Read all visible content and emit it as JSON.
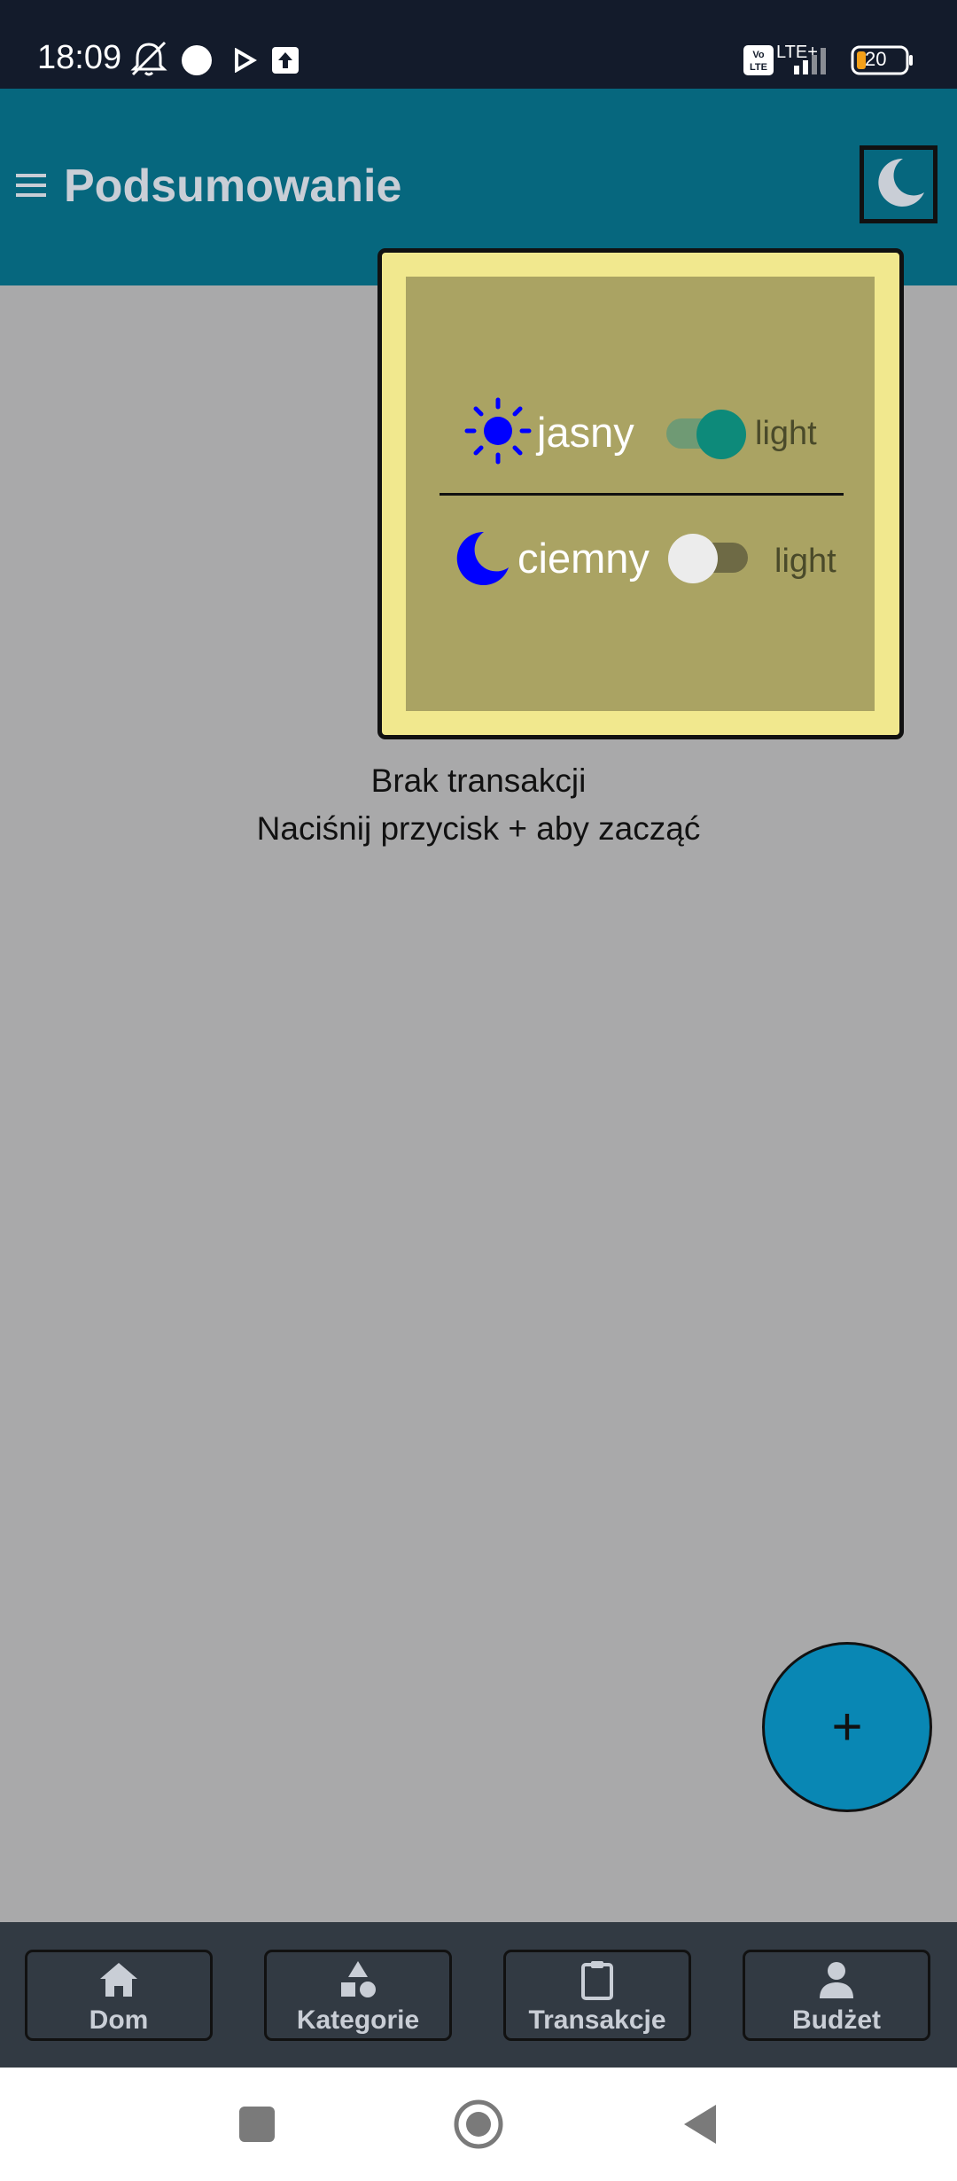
{
  "status_bar": {
    "time": "18:09",
    "network": "LTE+",
    "volte": "Vo LTE",
    "battery": "20"
  },
  "app_bar": {
    "title": "Podsumowanie",
    "menu_icon": "hamburger-menu-icon",
    "theme_icon": "moon-icon"
  },
  "theme_popup": {
    "options": [
      {
        "icon": "sun-icon",
        "label": "jasny",
        "switch_on": true,
        "switch_text": "light"
      },
      {
        "icon": "moon-icon",
        "label": "ciemny",
        "switch_on": false,
        "switch_text": "light"
      }
    ]
  },
  "empty_state": {
    "line1": "Brak transakcji",
    "line2": "Naciśnij przycisk + aby zacząć"
  },
  "fab": {
    "label": "+"
  },
  "bottom_nav": {
    "items": [
      {
        "label": "Dom",
        "icon": "home-icon"
      },
      {
        "label": "Kategorie",
        "icon": "shapes-icon"
      },
      {
        "label": "Transakcje",
        "icon": "clipboard-icon"
      },
      {
        "label": "Budżet",
        "icon": "person-icon"
      }
    ]
  },
  "system_nav": {
    "items": [
      "recents-button",
      "home-button",
      "back-button"
    ]
  },
  "colors": {
    "status_bar": "#131b2b",
    "app_bar": "#06677e",
    "background": "#a9a9aa",
    "popup_border": "#f1e88e",
    "popup_inner": "#aaa363",
    "switch_on": "#0d8a7a",
    "fab": "#0987b4",
    "bottom_nav": "#323a43",
    "icon_blue": "#0000ff"
  }
}
